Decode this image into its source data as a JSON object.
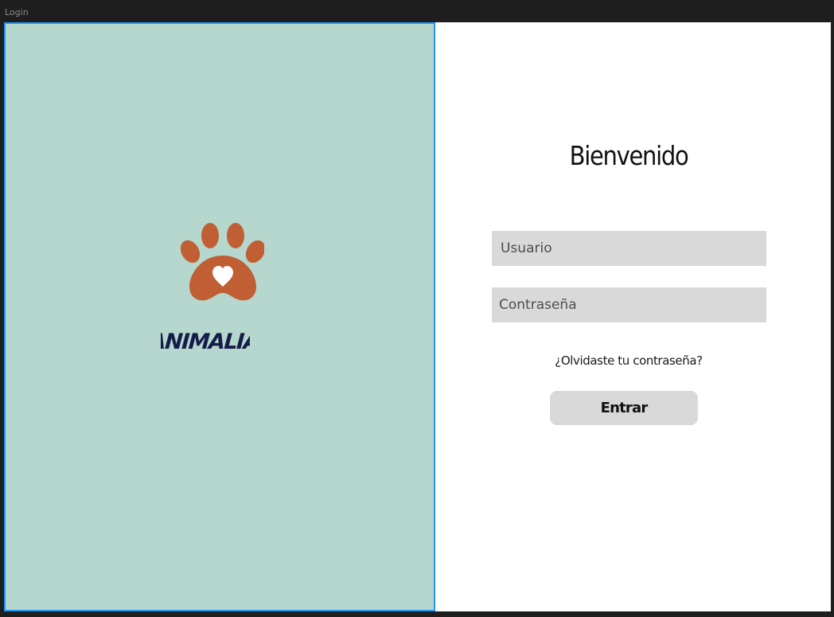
{
  "canvas": {
    "frame_label": "Login"
  },
  "brand": {
    "logo_icon": "paw-heart-icon",
    "name": "ANIMALIA"
  },
  "login": {
    "title": "Bienvenido",
    "username_placeholder": "Usuario",
    "password_placeholder": "Contraseña",
    "forgot_link": "¿Olvidaste tu contraseña?",
    "submit_label": "Entrar"
  },
  "colors": {
    "canvas_bg": "#1e1e1e",
    "left_panel_bg": "#b5d7cd",
    "selection_border": "#2196f3",
    "paw": "#c05f34",
    "brand_text": "#161b4a",
    "input_bg": "#d9d9d9"
  }
}
